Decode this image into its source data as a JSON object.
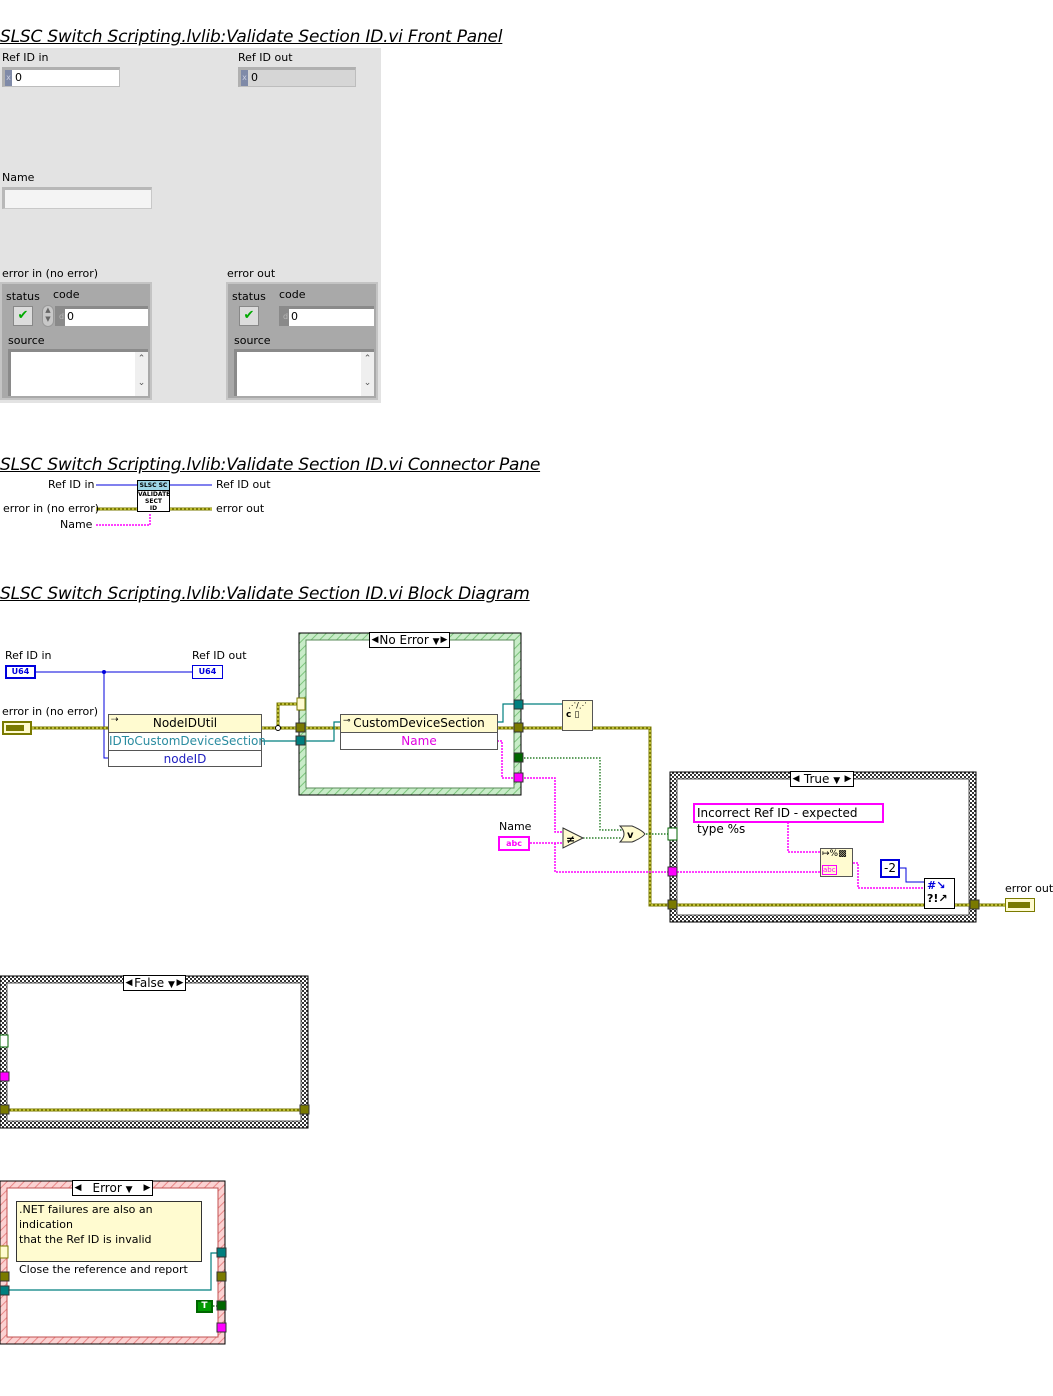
{
  "front_panel": {
    "title": "SLSC Switch Scripting.lvlib:Validate Section ID.vi Front Panel",
    "ref_id_in": {
      "label": "Ref ID in",
      "radix": "x",
      "value": "0"
    },
    "ref_id_out": {
      "label": "Ref ID out",
      "radix": "x",
      "value": "0"
    },
    "name": {
      "label": "Name",
      "value": ""
    },
    "error_in": {
      "label": "error in (no error)",
      "status_label": "status",
      "code_label": "code",
      "code_radix": "d",
      "code_value": "0",
      "source_label": "source",
      "source_value": "",
      "status_icon": "checkmark-icon"
    },
    "error_out": {
      "label": "error out",
      "status_label": "status",
      "code_label": "code",
      "code_radix": "d",
      "code_value": "0",
      "source_label": "source",
      "source_value": "",
      "status_icon": "checkmark-icon"
    }
  },
  "connector_pane": {
    "title": "SLSC Switch Scripting.lvlib:Validate Section ID.vi Connector Pane",
    "inputs": [
      "Ref ID in",
      "error in (no error)",
      "Name"
    ],
    "outputs": [
      "Ref ID out",
      "error out"
    ],
    "icon_text": [
      "SLSC SC",
      "VALIDATE",
      "SECT",
      "ID"
    ]
  },
  "block_diagram": {
    "title": "SLSC Switch Scripting.lvlib:Validate Section ID.vi Block Diagram",
    "terminals": {
      "ref_id_in": {
        "label": "Ref ID in",
        "type": "U64"
      },
      "ref_id_out": {
        "label": "Ref ID out",
        "type": "U64"
      },
      "error_in": {
        "label": "error in (no error)"
      },
      "error_out": {
        "label": "error out"
      },
      "name": {
        "label": "Name",
        "type": "abc"
      }
    },
    "invoke_node": {
      "class": "NodeIDUtil",
      "method": "IDToCustomDeviceSection",
      "param": "nodeID"
    },
    "property_node": {
      "class": "CustomDeviceSection",
      "property": "Name"
    },
    "case_error": {
      "selector": "No Error"
    },
    "case_bool_true": {
      "selector": "True"
    },
    "case_bool_false": {
      "selector": "False"
    },
    "case_error_alt": {
      "selector": "Error"
    },
    "format_string": "Incorrect Ref ID - expected type %s",
    "error_code_constant": "-2",
    "comment": [
      ".NET failures are also an indication",
      "that the Ref ID is invalid",
      "",
      "Close the reference and report"
    ],
    "bool_constant": "T",
    "colors": {
      "error_wire": "#7a7a00",
      "ref_wire": "#0000dd",
      "refnum_wire": "#007f7f",
      "string_wire": "#ff00ff",
      "bool_wire": "#006600",
      "case_error_border": "#8fd08f",
      "case_err_alt_border": "#f5a0a0"
    }
  }
}
